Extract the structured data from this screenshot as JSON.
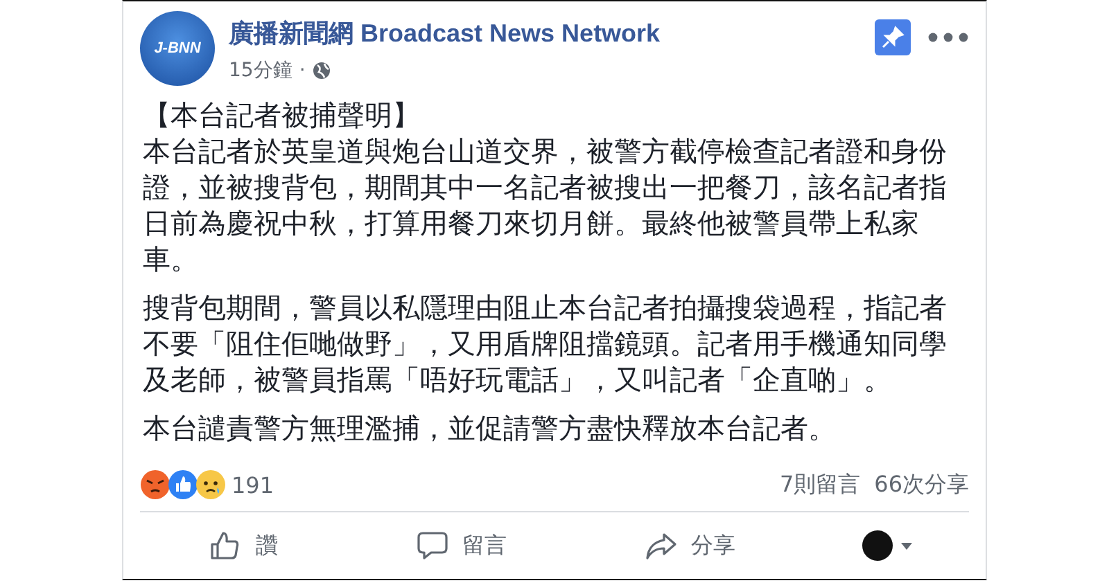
{
  "page": {
    "name": "廣播新聞網 Broadcast News Network",
    "logo_text": "J-BNN",
    "time": "15分鐘",
    "separator": "·",
    "pinned": true
  },
  "post": {
    "heading": "【本台記者被捕聲明】",
    "paragraphs": [
      "本台記者於英皇道與炮台山道交界，被警方截停檢查記者證和身份證，並被搜背包，期間其中一名記者被搜出一把餐刀，該名記者指日前為慶祝中秋，打算用餐刀來切月餅。最終他被警員帶上私家車。",
      "搜背包期間，警員以私隱理由阻止本台記者拍攝搜袋過程，指記者不要「阻住佢哋做野」，又用盾牌阻擋鏡頭。記者用手機通知同學及老師，被警員指罵「唔好玩電話」，又叫記者「企直啲」。",
      "本台譴責警方無理濫捕，並促請警方盡快釋放本台記者。"
    ]
  },
  "reactions": {
    "emoji": [
      {
        "kind": "angry"
      },
      {
        "kind": "like"
      },
      {
        "kind": "sad"
      }
    ],
    "count": "191",
    "comments": "7則留言",
    "shares": "66次分享"
  },
  "actions": [
    {
      "kind": "like",
      "label": "讚"
    },
    {
      "kind": "comment",
      "label": "留言"
    },
    {
      "kind": "share",
      "label": "分享"
    }
  ]
}
